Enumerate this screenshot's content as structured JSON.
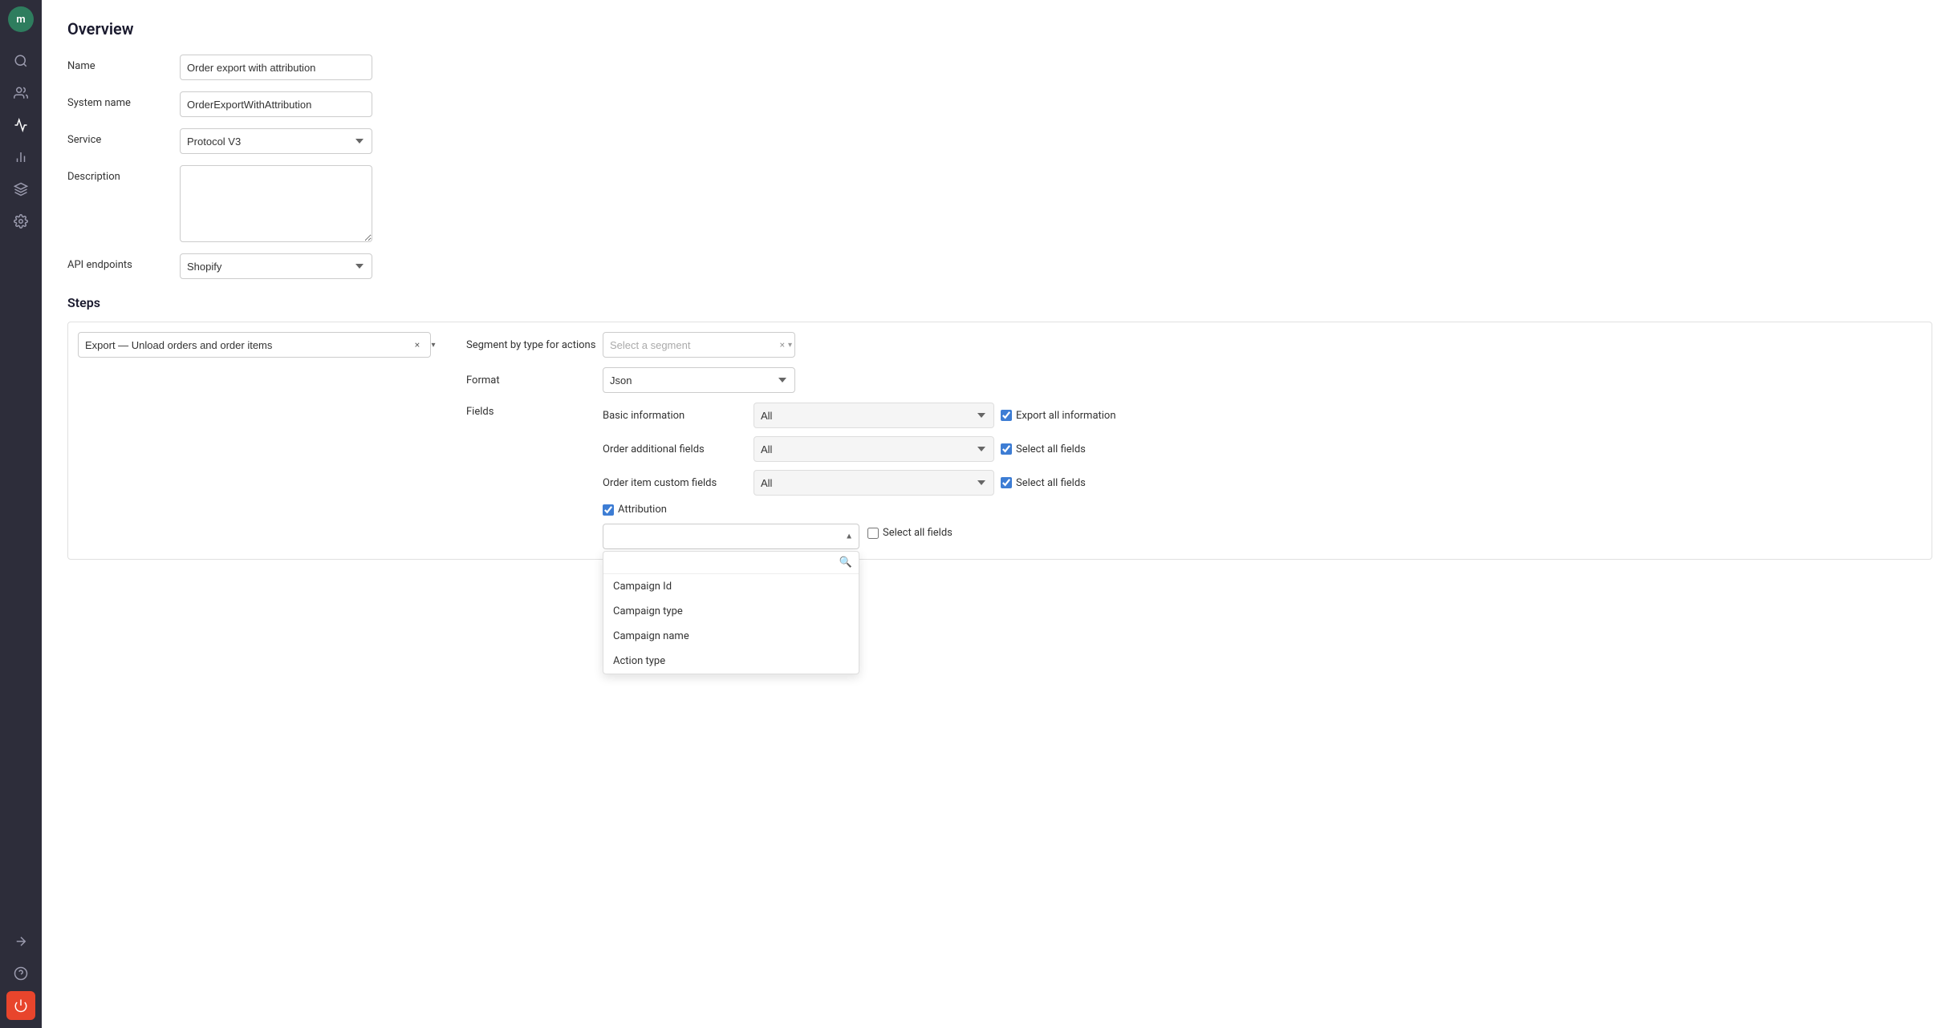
{
  "app": {
    "avatar_initials": "m"
  },
  "sidebar": {
    "items": [
      {
        "name": "search",
        "icon": "search"
      },
      {
        "name": "users",
        "icon": "users"
      },
      {
        "name": "campaigns",
        "icon": "megaphone",
        "active": true
      },
      {
        "name": "analytics",
        "icon": "bar-chart"
      },
      {
        "name": "integrations",
        "icon": "puzzle"
      },
      {
        "name": "settings",
        "icon": "gear"
      }
    ],
    "bottom_items": [
      {
        "name": "export",
        "icon": "arrow-right"
      },
      {
        "name": "help",
        "icon": "question"
      },
      {
        "name": "power",
        "icon": "power",
        "red": true
      }
    ]
  },
  "overview": {
    "title": "Overview",
    "fields": {
      "name_label": "Name",
      "name_value": "Order export with attribution",
      "system_name_label": "System name",
      "system_name_value": "OrderExportWithAttribution",
      "service_label": "Service",
      "service_value": "Protocol V3",
      "description_label": "Description",
      "description_placeholder": "",
      "api_endpoints_label": "API endpoints",
      "api_endpoints_value": "Shopify"
    }
  },
  "steps": {
    "title": "Steps",
    "step_select_value": "Export — Unload orders and order items",
    "segment_label": "Segment by type for actions",
    "segment_placeholder": "Select a segment",
    "format_label": "Format",
    "format_value": "Json",
    "fields_label": "Fields",
    "basic_info_label": "Basic information",
    "basic_info_value": "All",
    "basic_info_checkbox": "Export all information",
    "order_additional_label": "Order additional fields",
    "order_additional_value": "All",
    "order_additional_checkbox": "Select all fields",
    "order_item_label": "Order item custom fields",
    "order_item_value": "All",
    "order_item_checkbox": "Select all fields",
    "attribution_label": "Attribution",
    "attribution_select_placeholder": "",
    "select_all_fields_label": "Select all fields",
    "dropdown_search_placeholder": "",
    "dropdown_items": [
      {
        "label": "Campaign Id"
      },
      {
        "label": "Campaign type"
      },
      {
        "label": "Campaign name"
      },
      {
        "label": "Action type"
      }
    ]
  }
}
